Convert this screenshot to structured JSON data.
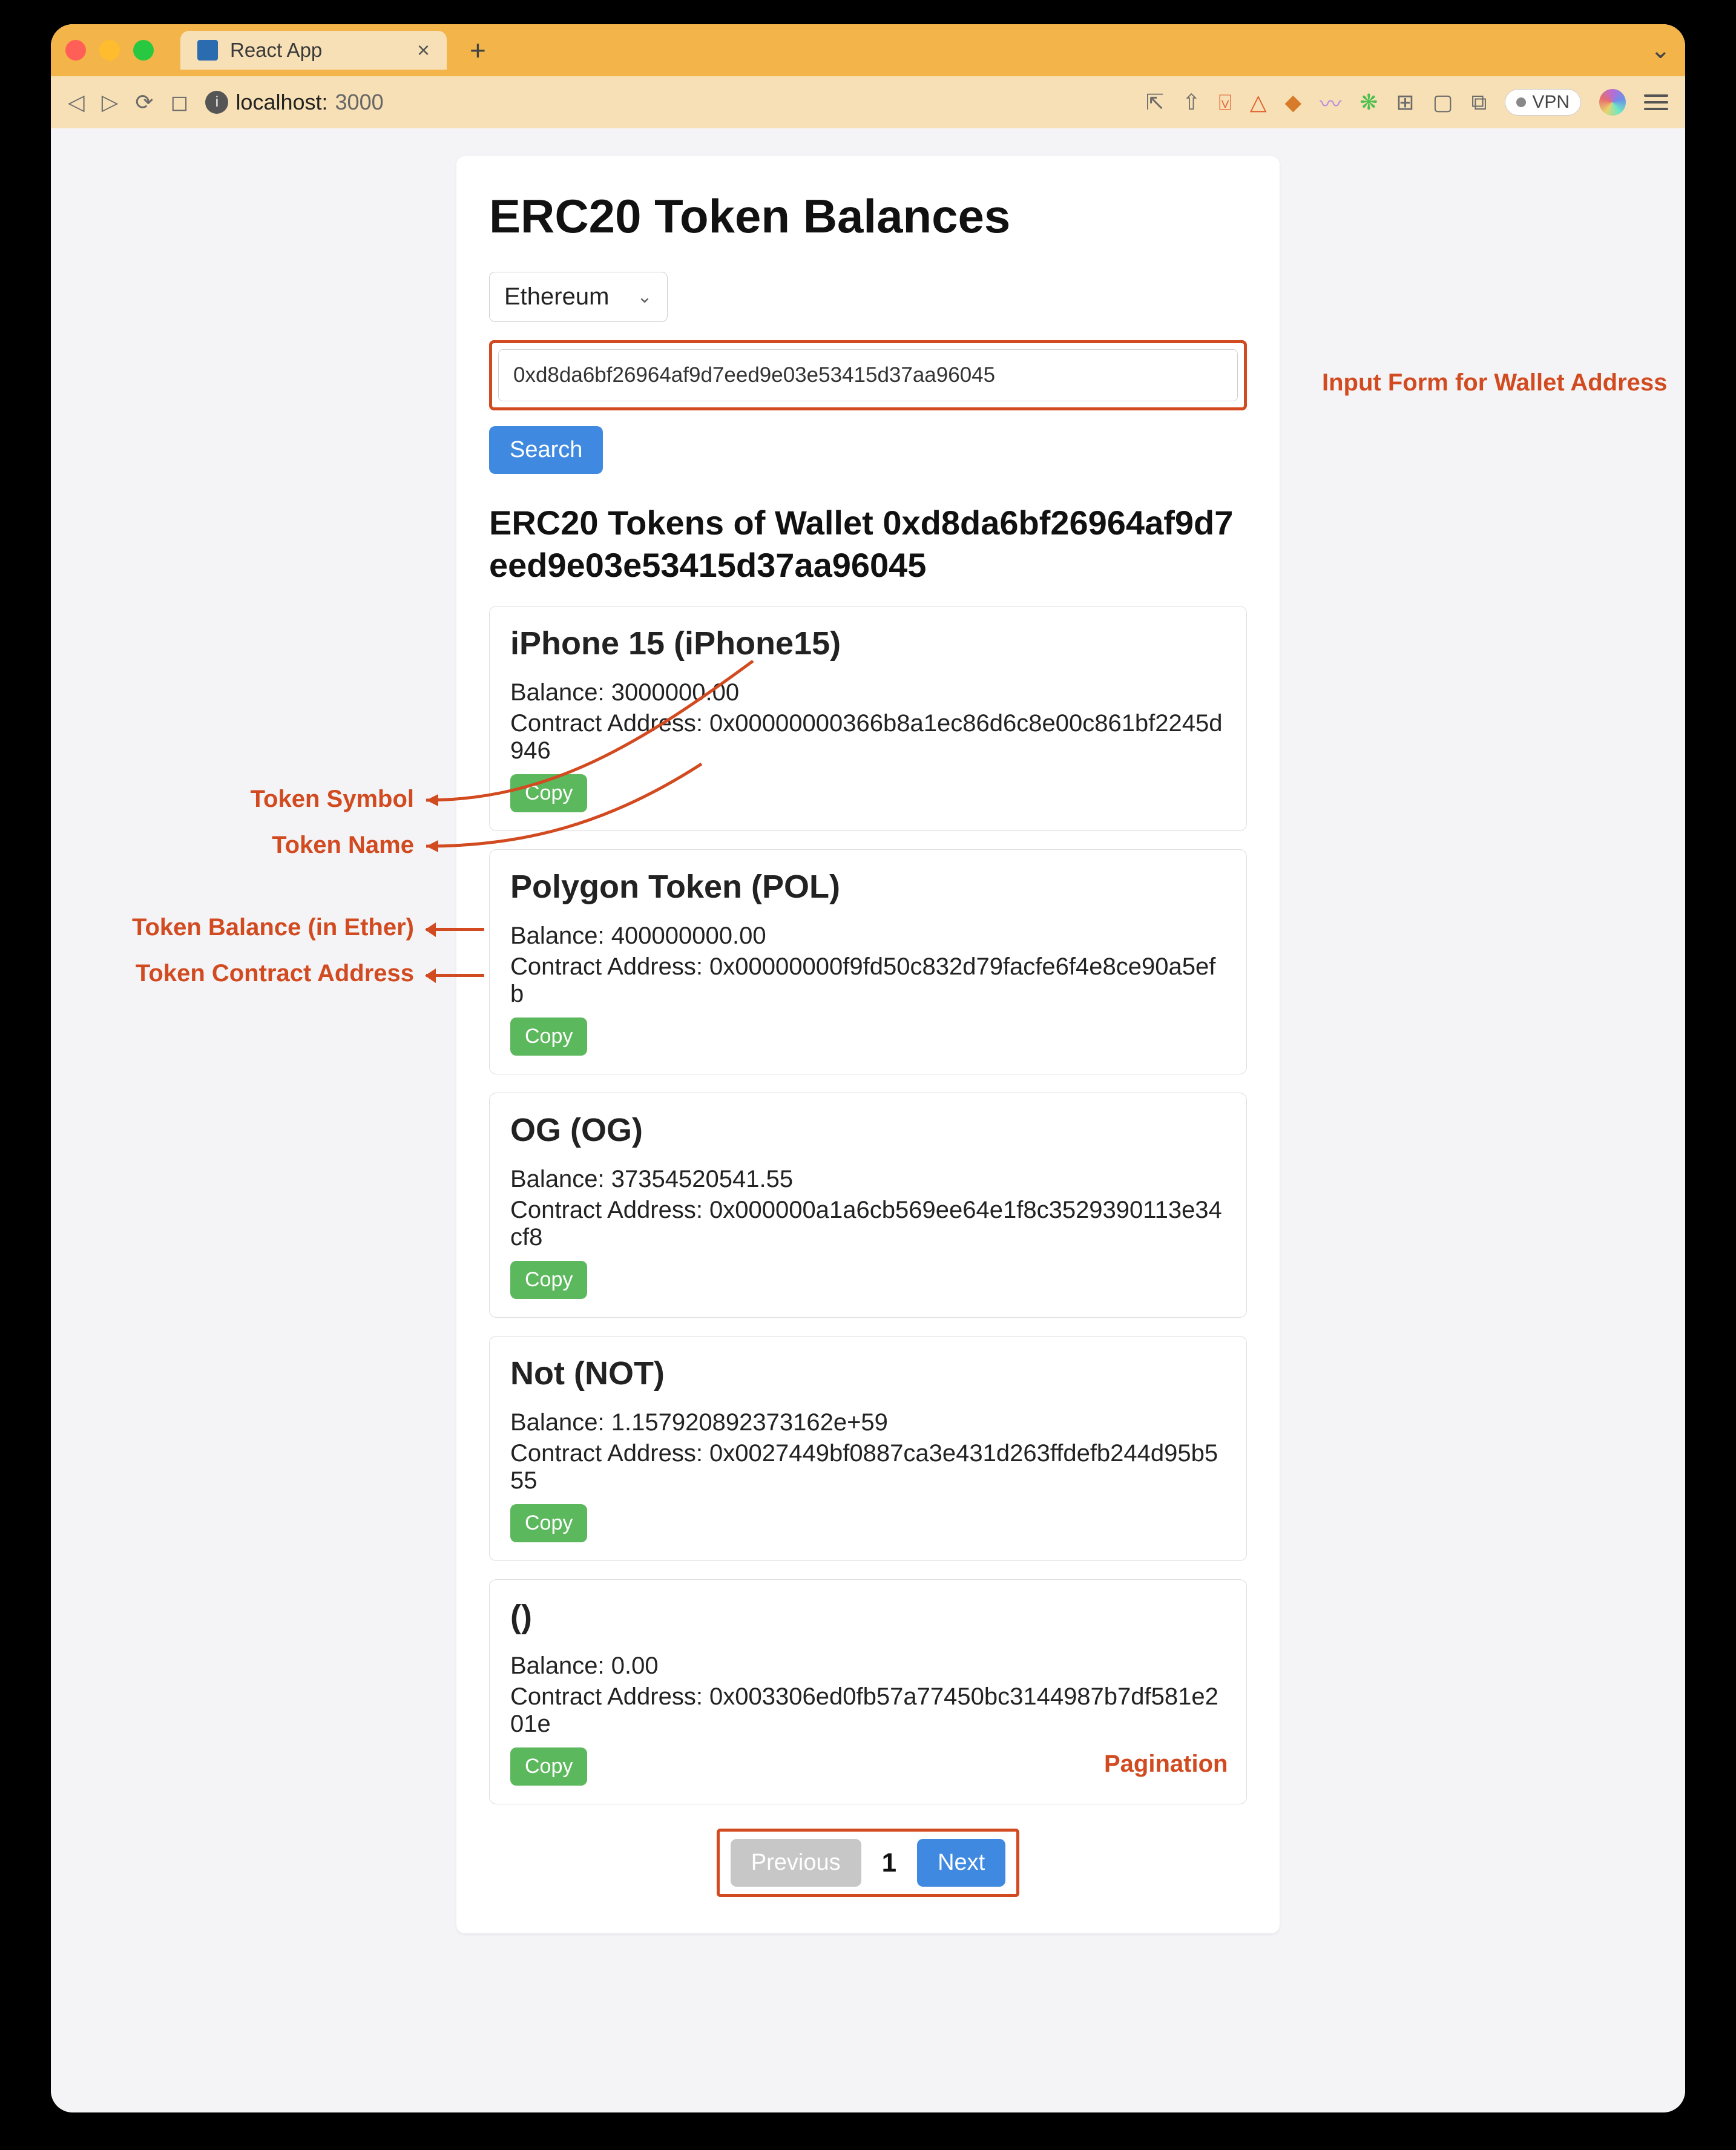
{
  "browser": {
    "tab_title": "React App",
    "host": "localhost:",
    "port": "3000",
    "vpn_label": "VPN"
  },
  "page": {
    "title": "ERC20 Token Balances",
    "network_selected": "Ethereum",
    "wallet_address": "0xd8da6bf26964af9d7eed9e03e53415d37aa96045",
    "search_label": "Search",
    "subhead_prefix": "ERC20 Tokens of Wallet",
    "copy_label": "Copy",
    "balance_label": "Balance:",
    "contract_label": "Contract Address:"
  },
  "tokens": [
    {
      "name": "iPhone 15",
      "symbol": "iPhone15",
      "balance": "3000000.00",
      "contract": "0x00000000366b8a1ec86d6c8e00c861bf2245d946"
    },
    {
      "name": "Polygon Token",
      "symbol": "POL",
      "balance": "400000000.00",
      "contract": "0x00000000f9fd50c832d79facfe6f4e8ce90a5efb"
    },
    {
      "name": "OG",
      "symbol": "OG",
      "balance": "37354520541.55",
      "contract": "0x000000a1a6cb569ee64e1f8c3529390113e34cf8"
    },
    {
      "name": "Not",
      "symbol": "NOT",
      "balance": "1.157920892373162e+59",
      "contract": "0x0027449bf0887ca3e431d263ffdefb244d95b555"
    },
    {
      "name": "",
      "symbol": "",
      "balance": "0.00",
      "contract": "0x003306ed0fb57a77450bc3144987b7df581e201e"
    }
  ],
  "pagination": {
    "previous": "Previous",
    "page": "1",
    "next": "Next"
  },
  "annotations": {
    "input_form": "Input Form for Wallet Address",
    "token_symbol": "Token Symbol",
    "token_name": "Token Name",
    "token_balance": "Token Balance (in Ether)",
    "token_contract": "Token Contract Address",
    "pagination": "Pagination"
  }
}
